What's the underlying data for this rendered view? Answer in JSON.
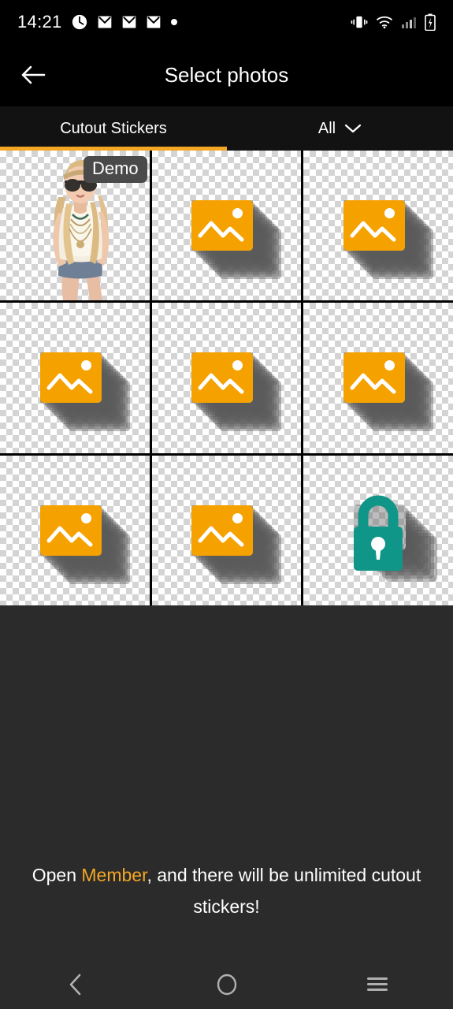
{
  "status_bar": {
    "time": "14:21",
    "left_icons": [
      "clock-icon",
      "mail-icon",
      "mail-icon",
      "mail-icon",
      "dot-icon"
    ],
    "right_icons": [
      "vibrate-icon",
      "wifi-icon",
      "signal-icon",
      "battery-charging-icon"
    ]
  },
  "header": {
    "title": "Select photos",
    "back_icon": "arrow-left-icon"
  },
  "tabs": {
    "active_index": 0,
    "items": [
      {
        "label": "Cutout Stickers"
      }
    ],
    "filter": {
      "label": "All",
      "chevron_icon": "chevron-down-icon"
    },
    "accent_color": "#f5a623"
  },
  "grid": {
    "columns": 3,
    "rows": 3,
    "cells": [
      {
        "type": "photo",
        "badge": "Demo",
        "icon": "cutout-photo"
      },
      {
        "type": "placeholder",
        "icon": "image-placeholder-icon"
      },
      {
        "type": "placeholder",
        "icon": "image-placeholder-icon"
      },
      {
        "type": "placeholder",
        "icon": "image-placeholder-icon"
      },
      {
        "type": "placeholder",
        "icon": "image-placeholder-icon"
      },
      {
        "type": "placeholder",
        "icon": "image-placeholder-icon"
      },
      {
        "type": "placeholder",
        "icon": "image-placeholder-icon"
      },
      {
        "type": "placeholder",
        "icon": "image-placeholder-icon"
      },
      {
        "type": "locked",
        "icon": "lock-icon"
      }
    ],
    "placeholder_color": "#f5a100",
    "lock_color": "#109688"
  },
  "promo": {
    "prefix": "Open ",
    "highlight": "Member",
    "suffix": ", and there will be unlimited cutout stickers!",
    "highlight_color": "#f5a623"
  },
  "nav_bar": {
    "back_icon": "chevron-left-icon",
    "home_icon": "circle-icon",
    "recents_icon": "hamburger-icon"
  }
}
